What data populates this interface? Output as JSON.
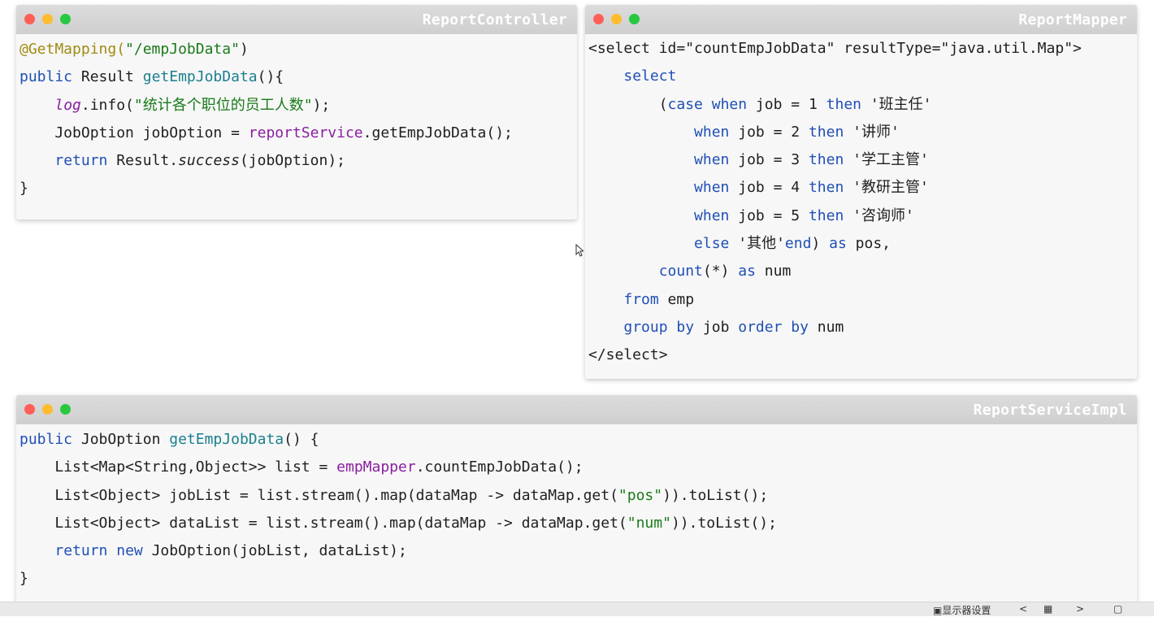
{
  "windows": {
    "controller": {
      "title": "ReportController",
      "lines": [
        [
          {
            "t": "@GetMapping(",
            "c": "ann"
          },
          {
            "t": "\"/empJobData\"",
            "c": "str"
          },
          {
            "t": ")",
            "c": ""
          }
        ],
        [
          {
            "t": "public",
            "c": "kw"
          },
          {
            "t": " Result ",
            "c": ""
          },
          {
            "t": "getEmpJobData",
            "c": "fn"
          },
          {
            "t": "(){",
            "c": ""
          }
        ],
        [
          {
            "t": "    ",
            "c": ""
          },
          {
            "t": "log",
            "c": "itfield"
          },
          {
            "t": ".info(",
            "c": ""
          },
          {
            "t": "\"统计各个职位的员工人数\"",
            "c": "str"
          },
          {
            "t": ");",
            "c": ""
          }
        ],
        [
          {
            "t": "    JobOption jobOption = ",
            "c": ""
          },
          {
            "t": "reportService",
            "c": "field"
          },
          {
            "t": ".getEmpJobData();",
            "c": ""
          }
        ],
        [
          {
            "t": "    ",
            "c": ""
          },
          {
            "t": "return",
            "c": "kw"
          },
          {
            "t": " Result.",
            "c": ""
          },
          {
            "t": "success",
            "c": "it"
          },
          {
            "t": "(jobOption);",
            "c": ""
          }
        ],
        [
          {
            "t": "}",
            "c": ""
          }
        ]
      ]
    },
    "mapper": {
      "title": "ReportMapper",
      "lines": [
        [
          {
            "t": "<select id=\"countEmpJobData\" resultType=\"java.util.Map\">",
            "c": ""
          }
        ],
        [
          {
            "t": "    ",
            "c": ""
          },
          {
            "t": "select",
            "c": "kw"
          }
        ],
        [
          {
            "t": "        (",
            "c": ""
          },
          {
            "t": "case when",
            "c": "kw"
          },
          {
            "t": " job = 1 ",
            "c": ""
          },
          {
            "t": "then",
            "c": "kw"
          },
          {
            "t": " '班主任'",
            "c": ""
          }
        ],
        [
          {
            "t": "            ",
            "c": ""
          },
          {
            "t": "when",
            "c": "kw"
          },
          {
            "t": " job = 2 ",
            "c": ""
          },
          {
            "t": "then",
            "c": "kw"
          },
          {
            "t": " '讲师'",
            "c": ""
          }
        ],
        [
          {
            "t": "            ",
            "c": ""
          },
          {
            "t": "when",
            "c": "kw"
          },
          {
            "t": " job = 3 ",
            "c": ""
          },
          {
            "t": "then",
            "c": "kw"
          },
          {
            "t": " '学工主管'",
            "c": ""
          }
        ],
        [
          {
            "t": "            ",
            "c": ""
          },
          {
            "t": "when",
            "c": "kw"
          },
          {
            "t": " job = 4 ",
            "c": ""
          },
          {
            "t": "then",
            "c": "kw"
          },
          {
            "t": " '教研主管'",
            "c": ""
          }
        ],
        [
          {
            "t": "            ",
            "c": ""
          },
          {
            "t": "when",
            "c": "kw"
          },
          {
            "t": " job = 5 ",
            "c": ""
          },
          {
            "t": "then",
            "c": "kw"
          },
          {
            "t": " '咨询师'",
            "c": ""
          }
        ],
        [
          {
            "t": "            ",
            "c": ""
          },
          {
            "t": "else",
            "c": "kw"
          },
          {
            "t": " '其他'",
            "c": ""
          },
          {
            "t": "end",
            "c": "kw"
          },
          {
            "t": ") ",
            "c": ""
          },
          {
            "t": "as",
            "c": "kw"
          },
          {
            "t": " pos,",
            "c": ""
          }
        ],
        [
          {
            "t": "        ",
            "c": ""
          },
          {
            "t": "count",
            "c": "kw"
          },
          {
            "t": "(*) ",
            "c": ""
          },
          {
            "t": "as",
            "c": "kw"
          },
          {
            "t": " num",
            "c": ""
          }
        ],
        [
          {
            "t": "    ",
            "c": ""
          },
          {
            "t": "from",
            "c": "kw"
          },
          {
            "t": " emp",
            "c": ""
          }
        ],
        [
          {
            "t": "    ",
            "c": ""
          },
          {
            "t": "group by",
            "c": "kw"
          },
          {
            "t": " job ",
            "c": ""
          },
          {
            "t": "order by",
            "c": "kw"
          },
          {
            "t": " num",
            "c": ""
          }
        ],
        [
          {
            "t": "</select>",
            "c": ""
          }
        ]
      ]
    },
    "service": {
      "title": "ReportServiceImpl",
      "lines": [
        [
          {
            "t": "public",
            "c": "kw"
          },
          {
            "t": " JobOption ",
            "c": ""
          },
          {
            "t": "getEmpJobData",
            "c": "fn"
          },
          {
            "t": "() {",
            "c": ""
          }
        ],
        [
          {
            "t": "    List<Map<String,Object>> list = ",
            "c": ""
          },
          {
            "t": "empMapper",
            "c": "field"
          },
          {
            "t": ".countEmpJobData();",
            "c": ""
          }
        ],
        [
          {
            "t": "    List<Object> jobList = list.stream().map(dataMap -> dataMap.get(",
            "c": ""
          },
          {
            "t": "\"pos\"",
            "c": "str"
          },
          {
            "t": ")).toList();",
            "c": ""
          }
        ],
        [
          {
            "t": "    List<Object> dataList = list.stream().map(dataMap -> dataMap.get(",
            "c": ""
          },
          {
            "t": "\"num\"",
            "c": "str"
          },
          {
            "t": ")).toList();",
            "c": ""
          }
        ],
        [
          {
            "t": "    ",
            "c": ""
          },
          {
            "t": "return",
            "c": "kw"
          },
          {
            "t": " ",
            "c": ""
          },
          {
            "t": "new",
            "c": "kw"
          },
          {
            "t": " JobOption(jobList, dataList);",
            "c": ""
          }
        ],
        [
          {
            "t": "}",
            "c": ""
          }
        ]
      ]
    }
  },
  "taskbar": {
    "display_settings": "显示器设置",
    "prev": "<",
    "next": ">"
  },
  "icons": [
    "display-icon",
    "grid-icon",
    "window-icon",
    "cursor-icon"
  ]
}
